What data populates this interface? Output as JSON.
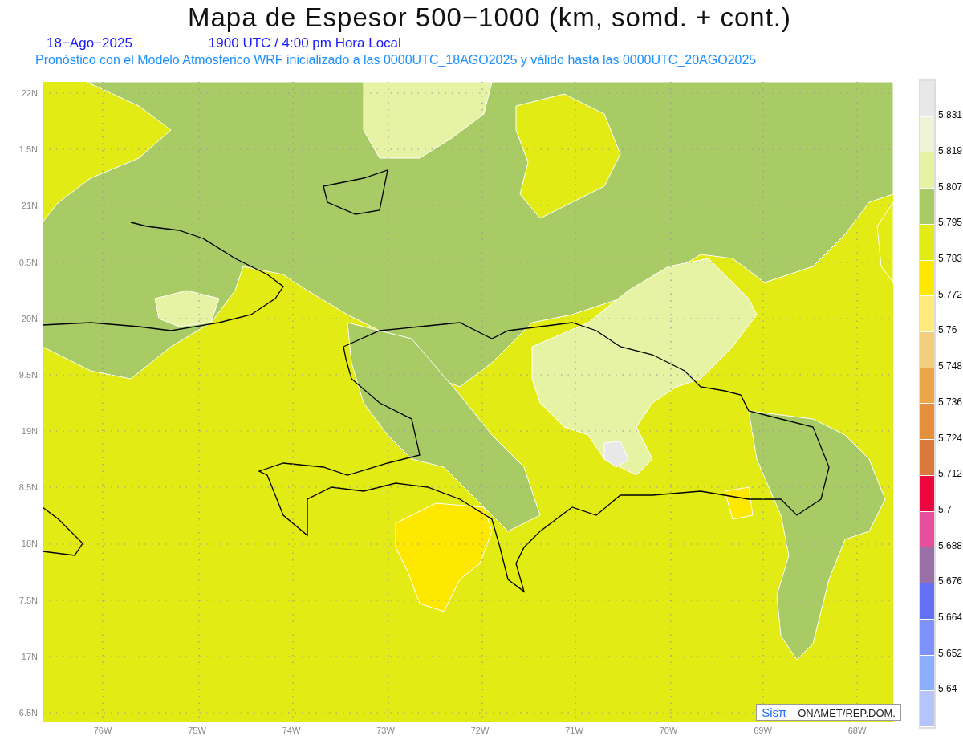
{
  "title": "Mapa de Espesor 500−1000 (km, somd. + cont.)",
  "date": "18−Ago−2025",
  "time": "1900 UTC / 4:00 pm Hora Local",
  "forecast": "Pronóstico con el Modelo Atmósferico WRF inicializado a las 0000UTC_18AGO2025 y válido hasta las  0000UTC_20AGO2025",
  "map": {
    "lat_labels": [
      "22N",
      "1.5N",
      "21N",
      "0.5N",
      "20N",
      "9.5N",
      "19N",
      "8.5N",
      "18N",
      "7.5N",
      "17N",
      "6.5N"
    ],
    "lon_labels": [
      "76W",
      "75W",
      "74W",
      "73W",
      "72W",
      "71W",
      "70W",
      "69W",
      "68W"
    ],
    "credit": {
      "logo": "Sisπ",
      "text": "– ONAMET/REP.DOM."
    }
  },
  "colorbar": {
    "swatches": [
      {
        "color": "#e8e8e8"
      },
      {
        "color": "#eef5d6"
      },
      {
        "color": "#e6f3a4"
      },
      {
        "color": "#a8cb66"
      },
      {
        "color": "#e2eb14"
      },
      {
        "color": "#ffe800"
      },
      {
        "color": "#ffea80"
      },
      {
        "color": "#f2cf7d"
      },
      {
        "color": "#eba54a"
      },
      {
        "color": "#e68f3c"
      },
      {
        "color": "#d97a3a"
      },
      {
        "color": "#ee073f"
      },
      {
        "color": "#e64f9e"
      },
      {
        "color": "#9a70a6"
      },
      {
        "color": "#6470f4"
      },
      {
        "color": "#7f91fb"
      },
      {
        "color": "#8caeff"
      },
      {
        "color": "#b5c5fc"
      }
    ],
    "labels": [
      "5.831",
      "5.819",
      "5.807",
      "5.795",
      "5.783",
      "5.772",
      "5.76",
      "5.748",
      "5.736",
      "5.724",
      "5.712",
      "5.7",
      "5.688",
      "5.676",
      "5.664",
      "5.652",
      "5.64"
    ]
  }
}
